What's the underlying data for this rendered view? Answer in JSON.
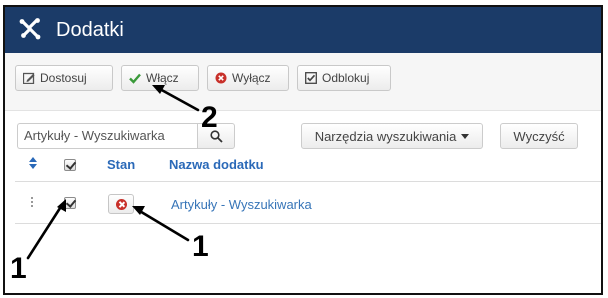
{
  "header": {
    "title": "Dodatki",
    "logo_icon": "joomla-logo-icon",
    "background": "#1b3b68"
  },
  "toolbar": {
    "buttons": [
      {
        "label": "Dostosuj",
        "icon": "edit-icon"
      },
      {
        "label": "Włącz",
        "icon": "check-icon"
      },
      {
        "label": "Wyłącz",
        "icon": "disable-icon"
      },
      {
        "label": "Odblokuj",
        "icon": "checkbox-icon"
      }
    ]
  },
  "search": {
    "value": "Artykuły - Wyszukiwarka",
    "search_icon": "search-icon",
    "tools_label": "Narzędzia wyszukiwania",
    "clear_label": "Wyczyść"
  },
  "table": {
    "columns": [
      "Stan",
      "Nazwa dodatku"
    ],
    "rows": [
      {
        "checked": true,
        "status": "disabled",
        "name": "Artykuły - Wyszukiwarka"
      }
    ]
  },
  "annotations": {
    "labels": [
      "1",
      "1",
      "2"
    ]
  }
}
